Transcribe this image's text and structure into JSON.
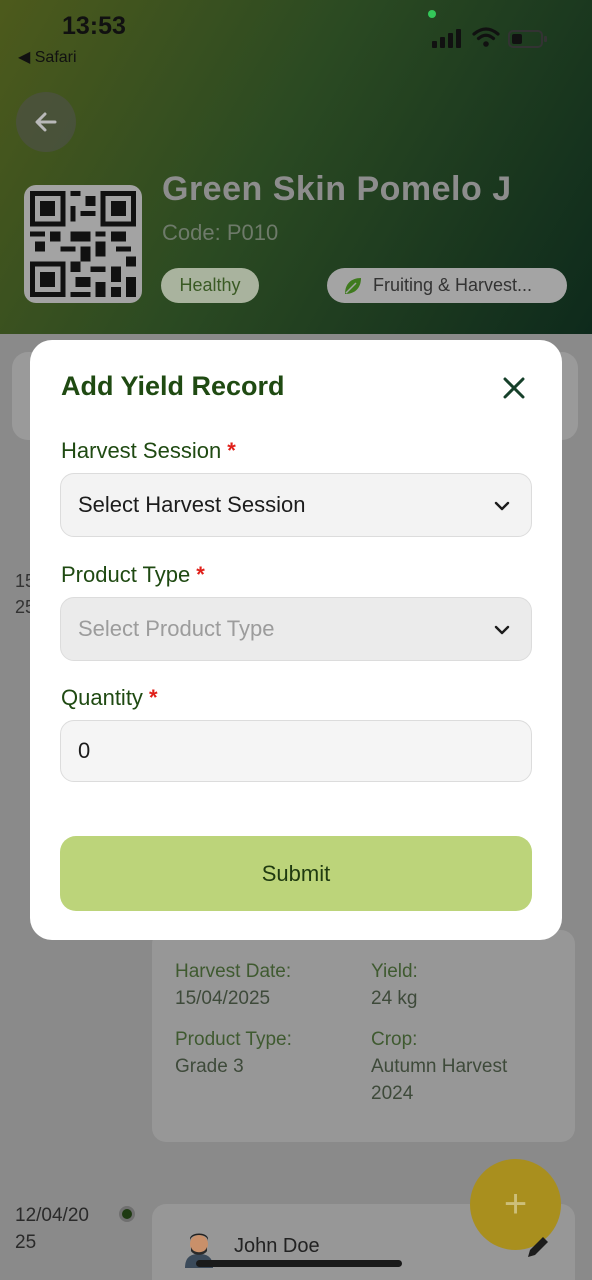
{
  "status_bar": {
    "time": "13:53",
    "back_app": "◀ Safari"
  },
  "header": {
    "plant_name": "Green Skin Pomelo J",
    "plant_code": "Code: P010",
    "health_badge": "Healthy",
    "stage_badge": "Fruiting & Harvest...",
    "icons": [
      "back-arrow-icon",
      "qr-code-icon",
      "leaf-icon"
    ]
  },
  "background": {
    "timeline_date_1": "15\n25",
    "record": {
      "harvest_date_label": "Harvest Date:",
      "harvest_date_value": "15/04/2025",
      "yield_label": "Yield:",
      "yield_value": "24 kg",
      "product_type_label": "Product Type:",
      "product_type_value": "Grade 3",
      "crop_label": "Crop:",
      "crop_value": "Autumn Harvest 2024"
    },
    "timeline_date_2": "12/04/20\n25",
    "user_name": "John Doe",
    "fab_label": "+"
  },
  "modal": {
    "title": "Add Yield Record",
    "harvest_session": {
      "label": "Harvest Session",
      "required_mark": "*",
      "value": "Select Harvest Session"
    },
    "product_type": {
      "label": "Product Type",
      "required_mark": "*",
      "placeholder": "Select Product Type"
    },
    "quantity": {
      "label": "Quantity",
      "required_mark": "*",
      "value": "0"
    },
    "submit_label": "Submit"
  },
  "colors": {
    "accent_green": "#1f4a12",
    "submit_bg": "#bcd47a",
    "required_red": "#e0201a",
    "fab": "#a98f1e"
  }
}
